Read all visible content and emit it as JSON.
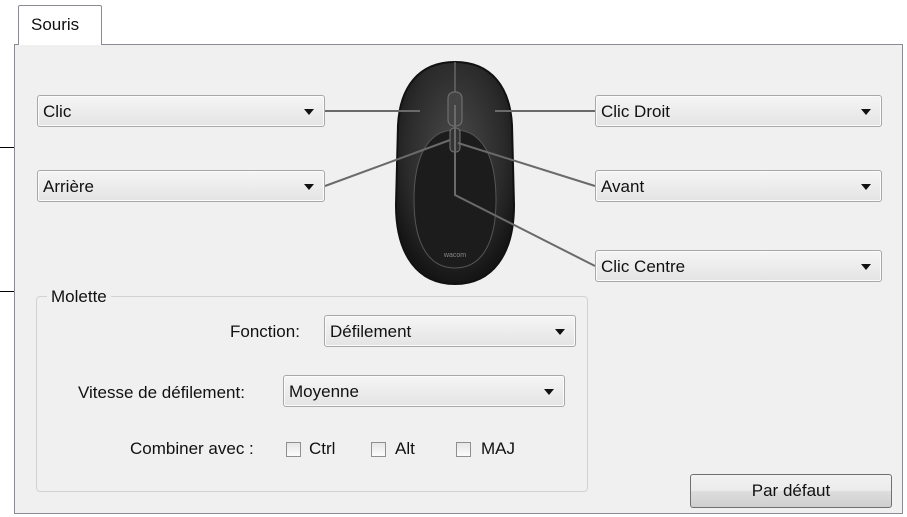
{
  "tab": {
    "label": "Souris"
  },
  "buttons_map": {
    "left_click": "Clic",
    "back": "Arrière",
    "right_click": "Clic Droit",
    "forward": "Avant",
    "middle_click": "Clic Centre"
  },
  "wheel": {
    "title": "Molette",
    "function_label": "Fonction:",
    "function_value": "Défilement",
    "speed_label": "Vitesse de défilement:",
    "speed_value": "Moyenne",
    "combine_label": "Combiner avec :",
    "modifiers": [
      {
        "label": "Ctrl",
        "checked": false
      },
      {
        "label": "Alt",
        "checked": false
      },
      {
        "label": "MAJ",
        "checked": false
      }
    ]
  },
  "default_button": "Par défaut",
  "mouse_brand": "wacom"
}
